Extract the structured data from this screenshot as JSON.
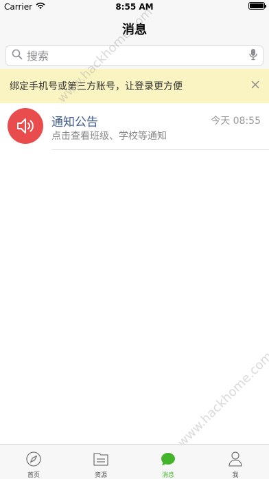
{
  "status_bar": {
    "carrier": "Carrier",
    "time": "8:55 AM",
    "battery_level": 1.0
  },
  "header": {
    "title": "消息"
  },
  "search": {
    "placeholder": "搜索"
  },
  "banner": {
    "text": "绑定手机号或第三方账号，让登录更方便",
    "close_icon": "close-icon"
  },
  "messages": [
    {
      "title": "通知公告",
      "time": "今天 08:55",
      "subtitle": "点击查看班级、学校等通知",
      "icon": "speaker-icon"
    }
  ],
  "tabs": [
    {
      "label": "首页",
      "icon": "compass-icon"
    },
    {
      "label": "资源",
      "icon": "folder-icon"
    },
    {
      "label": "消息",
      "icon": "chat-bubble-icon",
      "active": true
    },
    {
      "label": "我",
      "icon": "person-icon"
    }
  ],
  "watermark": {
    "text": "www.hackhome.com"
  },
  "colors": {
    "accent": "#44b52a",
    "banner_bg": "#faf4c2",
    "avatar_bg": "#e94c4c",
    "title": "#3e5a91"
  }
}
